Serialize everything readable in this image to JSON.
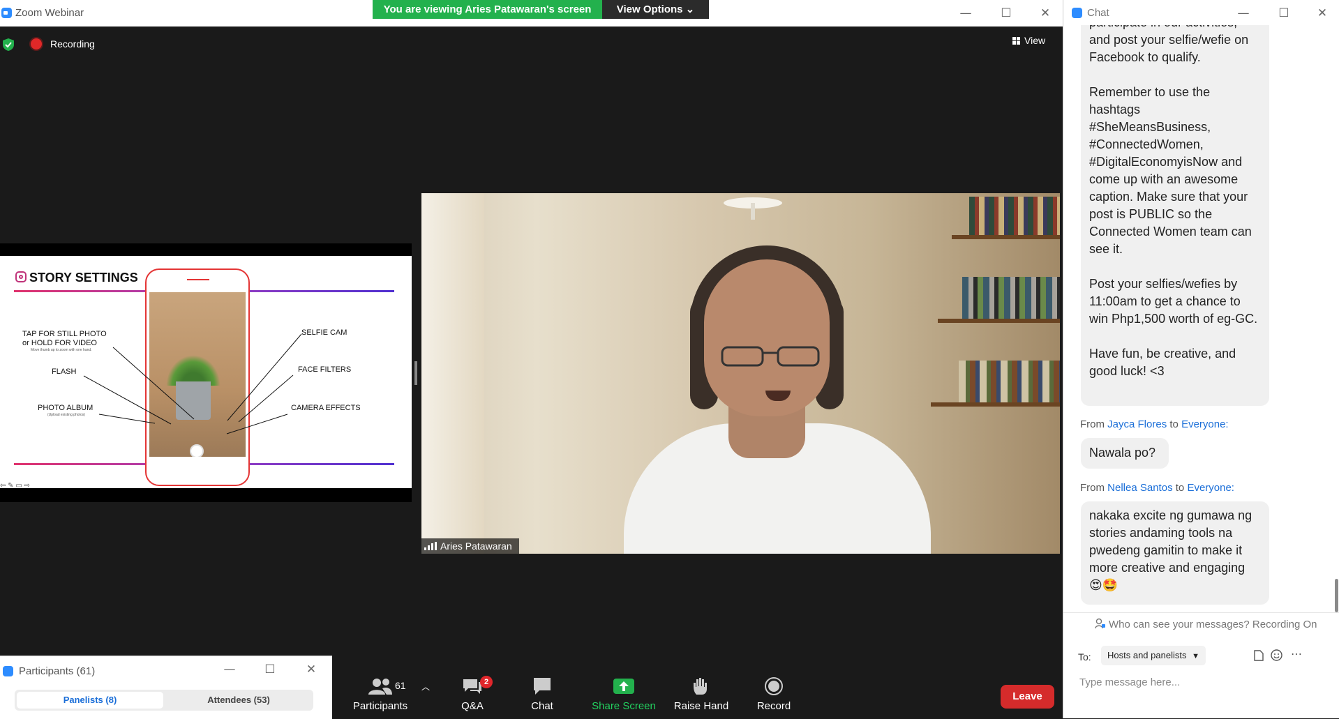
{
  "main_window": {
    "title": "Zoom Webinar",
    "banner_text": "You are viewing Aries Patawaran's screen",
    "view_options_label": "View Options ⌄",
    "recording_label": "Recording",
    "view_label": "View"
  },
  "slide": {
    "title": "STORY SETTINGS",
    "callouts": {
      "tap": "TAP FOR STILL PHOTO\nor HOLD FOR VIDEO",
      "tap_sub": "Move thumb up to zoom with one hand.",
      "flash": "FLASH",
      "album": "PHOTO ALBUM",
      "album_sub": "(Upload existing photos)",
      "selfie": "SELFIE CAM",
      "filters": "FACE FILTERS",
      "effects": "CAMERA EFFECTS"
    }
  },
  "video": {
    "participant_name": "Aries Patawaran"
  },
  "toolbar": {
    "participants_label": "Participants",
    "participants_count": "61",
    "qa_label": "Q&A",
    "qa_badge": "2",
    "chat_label": "Chat",
    "share_label": "Share Screen",
    "raise_label": "Raise Hand",
    "record_label": "Record",
    "leave_label": "Leave"
  },
  "participants_window": {
    "title": "Participants (61)",
    "tab_panelists": "Panelists (8)",
    "tab_attendees": "Attendees (53)"
  },
  "chat": {
    "title": "Chat",
    "messages": [
      {
        "paragraphs": [
          "participate in our activities,",
          "and post your selfie/wefie on Facebook to qualify.",
          "Remember to use the hashtags #SheMeansBusiness, #ConnectedWomen, #DigitalEconomyisNow and come up with an awesome caption. Make sure that your post is PUBLIC so the Connected Women team can see it.",
          "Post your selfies/wefies by 11:00am to get a chance to win Php1,500 worth of eg-GC.",
          "Have fun, be creative, and good luck! <3"
        ]
      },
      {
        "from_prefix": "From",
        "sender": "Jayca Flores",
        "to_word": "to",
        "recipient": "Everyone:",
        "text": "Nawala po?"
      },
      {
        "from_prefix": "From",
        "sender": "Nellea Santos",
        "to_word": "to",
        "recipient": "Everyone:",
        "text": "nakaka excite ng gumawa ng stories andaming tools na pwedeng gamitin to make it more creative and engaging",
        "emoji": "😍🤩"
      }
    ],
    "notice": "Who can see your messages? Recording On",
    "to_label": "To:",
    "recipient_select": "Hosts and panelists",
    "input_placeholder": "Type message here..."
  },
  "colors": {
    "zoom_blue": "#2d8cff",
    "banner_green": "#23b14d",
    "leave_red": "#d52b2b",
    "link_blue": "#1a6ed8"
  }
}
